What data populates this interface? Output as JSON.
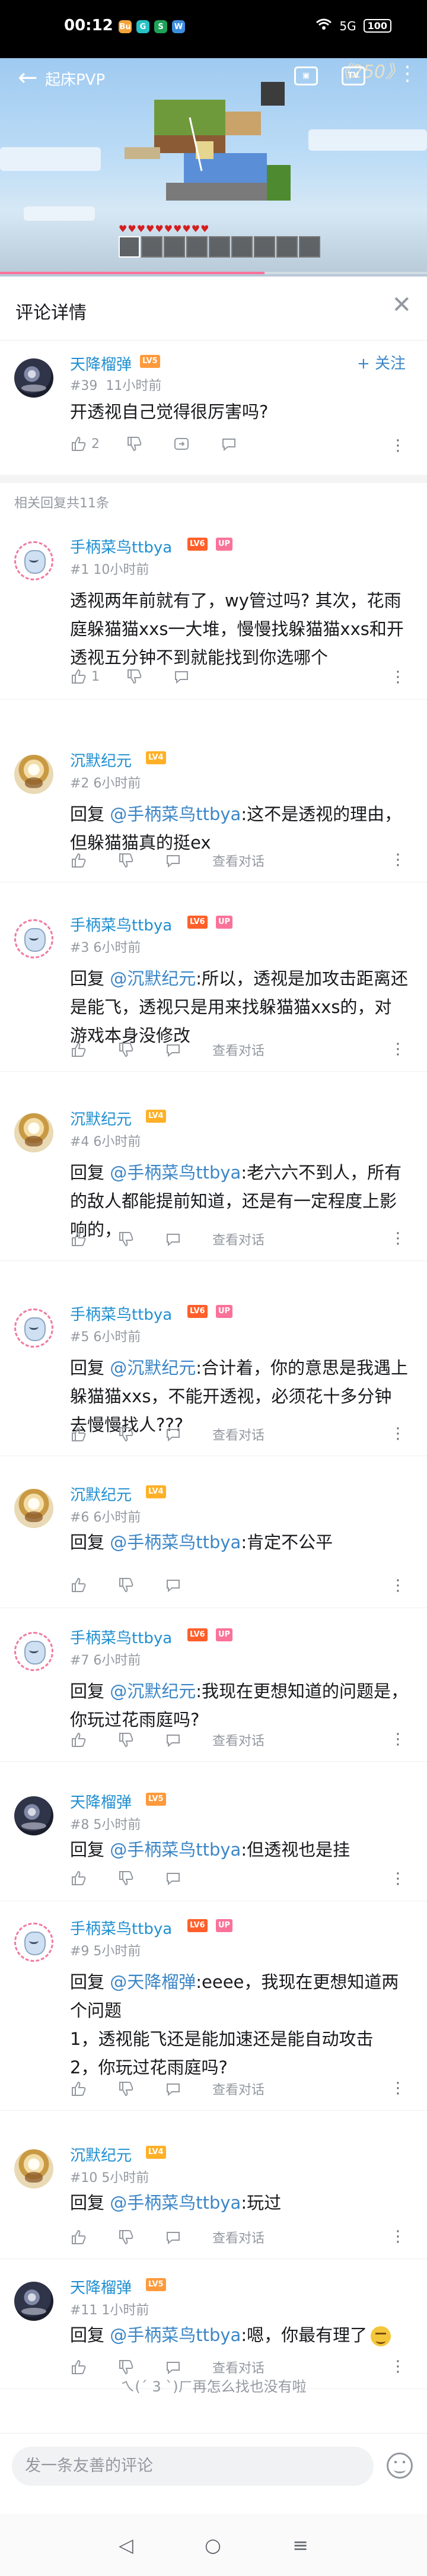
{
  "status_bar": {
    "time": "00:12",
    "apps": [
      "Bu",
      "G",
      "S",
      "W"
    ],
    "network": "5G",
    "signal": "5G ıll",
    "battery": "100"
  },
  "video": {
    "title": "起床PVP",
    "episode_badge": "《250》",
    "progress_fraction": 0.62
  },
  "header": {
    "title": "评论详情"
  },
  "root_comment": {
    "user": "天降榴弹",
    "level": "LV5",
    "floor": "#39",
    "time": "11小时前",
    "text": "开透视自己觉得很厉害吗?",
    "likes": "2",
    "follow_label": "+ 关注"
  },
  "replies_label": "相关回复共11条",
  "action_labels": {
    "view_conversation": "查看对话"
  },
  "replies": [
    {
      "user": "手柄菜鸟ttbya",
      "level": "LV6",
      "badge": "UP",
      "floor": "#1",
      "time": "10小时前",
      "reply_prefix": "",
      "mention": "",
      "text": "透视两年前就有了，wy管过吗? 其次，花雨庭躲猫猫xxs一大堆，慢慢找躲猫猫xxs和开透视五分钟不到就能找到你选哪个",
      "likes": "1",
      "show_conversation": false
    },
    {
      "user": "沉默纪元",
      "level": "LV4",
      "badge": "",
      "floor": "#2",
      "time": "6小时前",
      "reply_prefix": "回复 ",
      "mention": "@手柄菜鸟ttbya",
      "text": ":这不是透视的理由，但躲猫猫真的挺ex",
      "likes": "",
      "show_conversation": true
    },
    {
      "user": "手柄菜鸟ttbya",
      "level": "LV6",
      "badge": "UP",
      "floor": "#3",
      "time": "6小时前",
      "reply_prefix": "回复 ",
      "mention": "@沉默纪元",
      "text": ":所以，透视是加攻击距离还是能飞，透视只是用来找躲猫猫xxs的，对游戏本身没修改",
      "likes": "",
      "show_conversation": true
    },
    {
      "user": "沉默纪元",
      "level": "LV4",
      "badge": "",
      "floor": "#4",
      "time": "6小时前",
      "reply_prefix": "回复 ",
      "mention": "@手柄菜鸟ttbya",
      "text": ":老六六不到人，所有的敌人都能提前知道，还是有一定程度上影响的，",
      "likes": "",
      "show_conversation": true
    },
    {
      "user": "手柄菜鸟ttbya",
      "level": "LV6",
      "badge": "UP",
      "floor": "#5",
      "time": "6小时前",
      "reply_prefix": "回复 ",
      "mention": "@沉默纪元",
      "text": ":合计着，你的意思是我遇上躲猫猫xxs，不能开透视，必须花十多分钟去慢慢找人???",
      "likes": "",
      "show_conversation": true
    },
    {
      "user": "沉默纪元",
      "level": "LV4",
      "badge": "",
      "floor": "#6",
      "time": "6小时前",
      "reply_prefix": "回复 ",
      "mention": "@手柄菜鸟ttbya",
      "text": ":肯定不公平",
      "likes": "",
      "show_conversation": false
    },
    {
      "user": "手柄菜鸟ttbya",
      "level": "LV6",
      "badge": "UP",
      "floor": "#7",
      "time": "6小时前",
      "reply_prefix": "回复 ",
      "mention": "@沉默纪元",
      "text": ":我现在更想知道的问题是，你玩过花雨庭吗?",
      "likes": "",
      "show_conversation": true
    },
    {
      "user": "天降榴弹",
      "level": "LV5",
      "badge": "",
      "floor": "#8",
      "time": "5小时前",
      "reply_prefix": "回复 ",
      "mention": "@手柄菜鸟ttbya",
      "text": ":但透视也是挂",
      "likes": "",
      "show_conversation": false
    },
    {
      "user": "手柄菜鸟ttbya",
      "level": "LV6",
      "badge": "UP",
      "floor": "#9",
      "time": "5小时前",
      "reply_prefix": "回复 ",
      "mention": "@天降榴弹",
      "text": ":eeee，我现在更想知道两个问题\n1，透视能飞还是能加速还是能自动攻击\n2，你玩过花雨庭吗?",
      "likes": "",
      "show_conversation": true
    },
    {
      "user": "沉默纪元",
      "level": "LV4",
      "badge": "",
      "floor": "#10",
      "time": "5小时前",
      "reply_prefix": "回复 ",
      "mention": "@手柄菜鸟ttbya",
      "text": ":玩过",
      "likes": "",
      "show_conversation": true
    },
    {
      "user": "天降榴弹",
      "level": "LV5",
      "badge": "",
      "floor": "#11",
      "time": "1小时前",
      "reply_prefix": "回复 ",
      "mention": "@手柄菜鸟ttbya",
      "text": ":嗯，你最有理了",
      "likes": "",
      "show_conversation": true
    }
  ],
  "end_text": "ㄟ(ˊ 3 ˋ)ㄏ再怎么找也没有啦",
  "input": {
    "placeholder": "发一条友善的评论"
  },
  "nav": {
    "back": "◁",
    "home": "○",
    "recents": "≡"
  },
  "colors": {
    "accent_pink": "#fb7299",
    "link_blue": "#3b86c7"
  }
}
